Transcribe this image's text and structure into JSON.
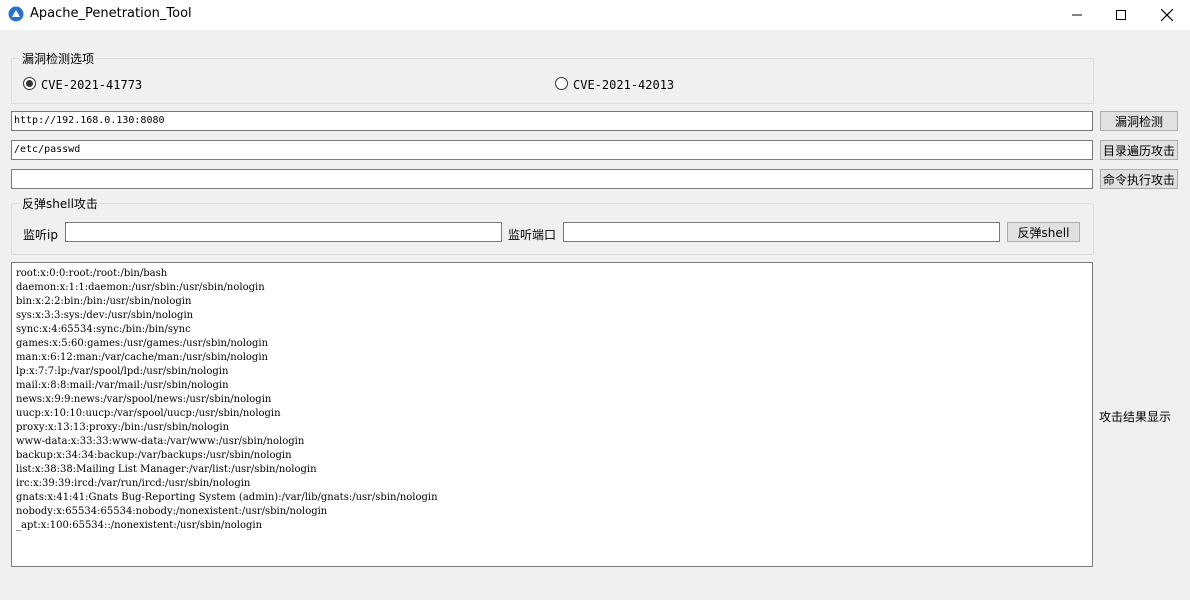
{
  "window": {
    "title": "Apache_Penetration_Tool"
  },
  "vuln_options": {
    "group_label": "漏洞检测选项",
    "options": [
      {
        "label": "CVE-2021-41773",
        "selected": true
      },
      {
        "label": "CVE-2021-42013",
        "selected": false
      }
    ]
  },
  "url_input": {
    "value": "http://192.168.0.130:8080"
  },
  "path_input": {
    "value": "/etc/passwd"
  },
  "cmd_input": {
    "value": ""
  },
  "buttons": {
    "vuln_check": "漏洞检测",
    "dir_traversal": "目录遍历攻击",
    "cmd_exec": "命令执行攻击",
    "reverse_shell": "反弹shell"
  },
  "reverse_shell": {
    "group_label": "反弹shell攻击",
    "ip_label": "监听ip",
    "ip_value": "",
    "port_label": "监听端口",
    "port_value": ""
  },
  "output": {
    "side_label": "攻击结果显示",
    "lines": [
      "root:x:0:0:root:/root:/bin/bash",
      "daemon:x:1:1:daemon:/usr/sbin:/usr/sbin/nologin",
      "bin:x:2:2:bin:/bin:/usr/sbin/nologin",
      "sys:x:3:3:sys:/dev:/usr/sbin/nologin",
      "sync:x:4:65534:sync:/bin:/bin/sync",
      "games:x:5:60:games:/usr/games:/usr/sbin/nologin",
      "man:x:6:12:man:/var/cache/man:/usr/sbin/nologin",
      "lp:x:7:7:lp:/var/spool/lpd:/usr/sbin/nologin",
      "mail:x:8:8:mail:/var/mail:/usr/sbin/nologin",
      "news:x:9:9:news:/var/spool/news:/usr/sbin/nologin",
      "uucp:x:10:10:uucp:/var/spool/uucp:/usr/sbin/nologin",
      "proxy:x:13:13:proxy:/bin:/usr/sbin/nologin",
      "www-data:x:33:33:www-data:/var/www:/usr/sbin/nologin",
      "backup:x:34:34:backup:/var/backups:/usr/sbin/nologin",
      "list:x:38:38:Mailing List Manager:/var/list:/usr/sbin/nologin",
      "irc:x:39:39:ircd:/var/run/ircd:/usr/sbin/nologin",
      "gnats:x:41:41:Gnats Bug-Reporting System (admin):/var/lib/gnats:/usr/sbin/nologin",
      "nobody:x:65534:65534:nobody:/nonexistent:/usr/sbin/nologin",
      "_apt:x:100:65534::/nonexistent:/usr/sbin/nologin"
    ]
  }
}
